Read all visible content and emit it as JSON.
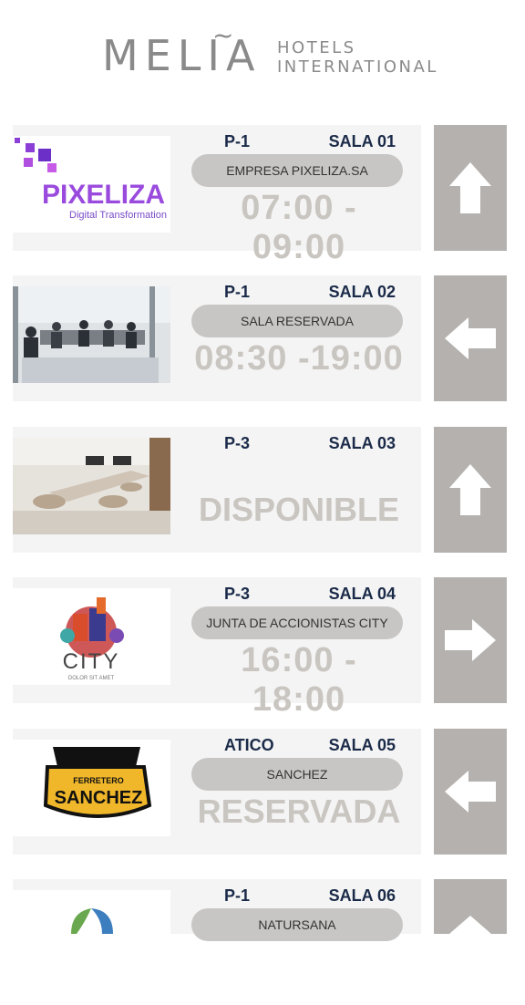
{
  "brand": {
    "name": "MELIA",
    "tilde": "~",
    "sub1": "HOTELS",
    "sub2": "INTERNATIONAL"
  },
  "rooms": [
    {
      "floor": "P-1",
      "sala": "SALA 01",
      "event": "EMPRESA PIXELIZA.SA",
      "time": "07:00 - 09:00",
      "status": "",
      "arrow": "up-arrow-icon",
      "logo": {
        "title": "PIXELIZA",
        "sub": "Digital Transformation"
      }
    },
    {
      "floor": "P-1",
      "sala": "SALA 02",
      "event": "SALA RESERVADA",
      "time": "08:30 -19:00",
      "status": "",
      "arrow": "left-arrow-icon"
    },
    {
      "floor": "P-3",
      "sala": "SALA 03",
      "event": "",
      "time": "",
      "status": "DISPONIBLE",
      "arrow": "up-arrow-icon"
    },
    {
      "floor": "P-3",
      "sala": "SALA 04",
      "event": "JUNTA DE ACCIONISTAS CITY",
      "time": "16:00 - 18:00",
      "status": "",
      "arrow": "right-arrow-icon",
      "logo": {
        "title": "CITY",
        "sub": "DOLOR SIT AMET"
      }
    },
    {
      "floor": "ATICO",
      "sala": "SALA 05",
      "event": "SANCHEZ",
      "time": "",
      "status": "RESERVADA",
      "arrow": "left-arrow-icon",
      "logo": {
        "title": "SANCHEZ",
        "sub": "FERRETERO"
      }
    },
    {
      "floor": "P-1",
      "sala": "SALA 06",
      "event": "NATURSANA",
      "time": "",
      "status": "",
      "arrow": "up-arrow-icon"
    }
  ],
  "colors": {
    "pill": "#c8c6c4",
    "arrow_bg": "#b4b1ae",
    "time": "#c9c5c0",
    "labels": "#1a2a48"
  }
}
